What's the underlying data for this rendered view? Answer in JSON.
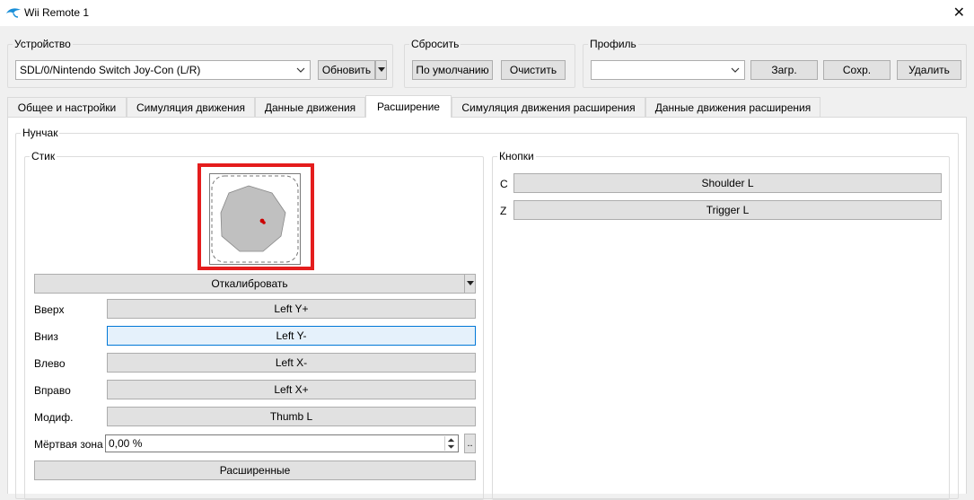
{
  "window": {
    "title": "Wii Remote 1",
    "icon": "dolphin-icon"
  },
  "device": {
    "legend": "Устройство",
    "selected": "SDL/0/Nintendo Switch Joy-Con (L/R)",
    "refresh_label": "Обновить"
  },
  "reset": {
    "legend": "Сбросить",
    "default_label": "По умолчанию",
    "clear_label": "Очистить"
  },
  "profile": {
    "legend": "Профиль",
    "selected": "",
    "load_label": "Загр.",
    "save_label": "Сохр.",
    "delete_label": "Удалить"
  },
  "tabs": [
    {
      "label": "Общее и настройки"
    },
    {
      "label": "Симуляция движения"
    },
    {
      "label": "Данные движения"
    },
    {
      "label": "Расширение",
      "active": true
    },
    {
      "label": "Симуляция движения расширения"
    },
    {
      "label": "Данные движения расширения"
    }
  ],
  "nunchuk": {
    "legend": "Нунчак",
    "stick": {
      "legend": "Стик",
      "calibrate_label": "Откалибровать",
      "rows": [
        {
          "label": "Вверх",
          "value": "Left Y+"
        },
        {
          "label": "Вниз",
          "value": "Left Y-"
        },
        {
          "label": "Влево",
          "value": "Left X-"
        },
        {
          "label": "Вправо",
          "value": "Left X+"
        },
        {
          "label": "Модиф.",
          "value": "Thumb L"
        }
      ],
      "deadzone_label": "Мёртвая зона",
      "deadzone_value": "0,00 %",
      "dots_label": "..",
      "advanced_label": "Расширенные"
    },
    "buttons": {
      "legend": "Кнопки",
      "rows": [
        {
          "label": "C",
          "value": "Shoulder L"
        },
        {
          "label": "Z",
          "value": "Trigger L"
        }
      ]
    }
  },
  "colors": {
    "highlight": "#e41d1d",
    "focus": "#0078d7",
    "gate_fill": "#c0c0c0",
    "stick_dot": "#cc0000"
  }
}
